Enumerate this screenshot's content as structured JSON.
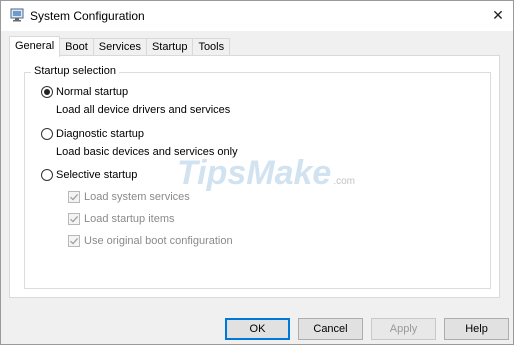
{
  "window": {
    "title": "System Configuration",
    "close_glyph": "✕"
  },
  "tabs": [
    {
      "label": "General",
      "active": true
    },
    {
      "label": "Boot",
      "active": false
    },
    {
      "label": "Services",
      "active": false
    },
    {
      "label": "Startup",
      "active": false
    },
    {
      "label": "Tools",
      "active": false
    }
  ],
  "startup_selection": {
    "legend": "Startup selection",
    "normal": {
      "label": "Normal startup",
      "description": "Load all device drivers and services",
      "selected": true
    },
    "diagnostic": {
      "label": "Diagnostic startup",
      "description": "Load basic devices and services only",
      "selected": false
    },
    "selective": {
      "label": "Selective startup",
      "selected": false,
      "options": [
        {
          "label": "Load system services",
          "checked": true,
          "enabled": false
        },
        {
          "label": "Load startup items",
          "checked": true,
          "enabled": false
        },
        {
          "label": "Use original boot configuration",
          "checked": true,
          "enabled": false
        }
      ]
    }
  },
  "watermark": {
    "main": "TipsMake",
    "suffix": ".com"
  },
  "buttons": {
    "ok": "OK",
    "cancel": "Cancel",
    "apply": "Apply",
    "help": "Help"
  },
  "icons": {
    "app": "system-configuration-icon",
    "close": "close-icon",
    "radio_selected": "radio-selected",
    "checkbox_checked": "checkmark-icon"
  },
  "colors": {
    "default_button_border": "#0078d7",
    "disabled_text": "#8a8a8a"
  }
}
